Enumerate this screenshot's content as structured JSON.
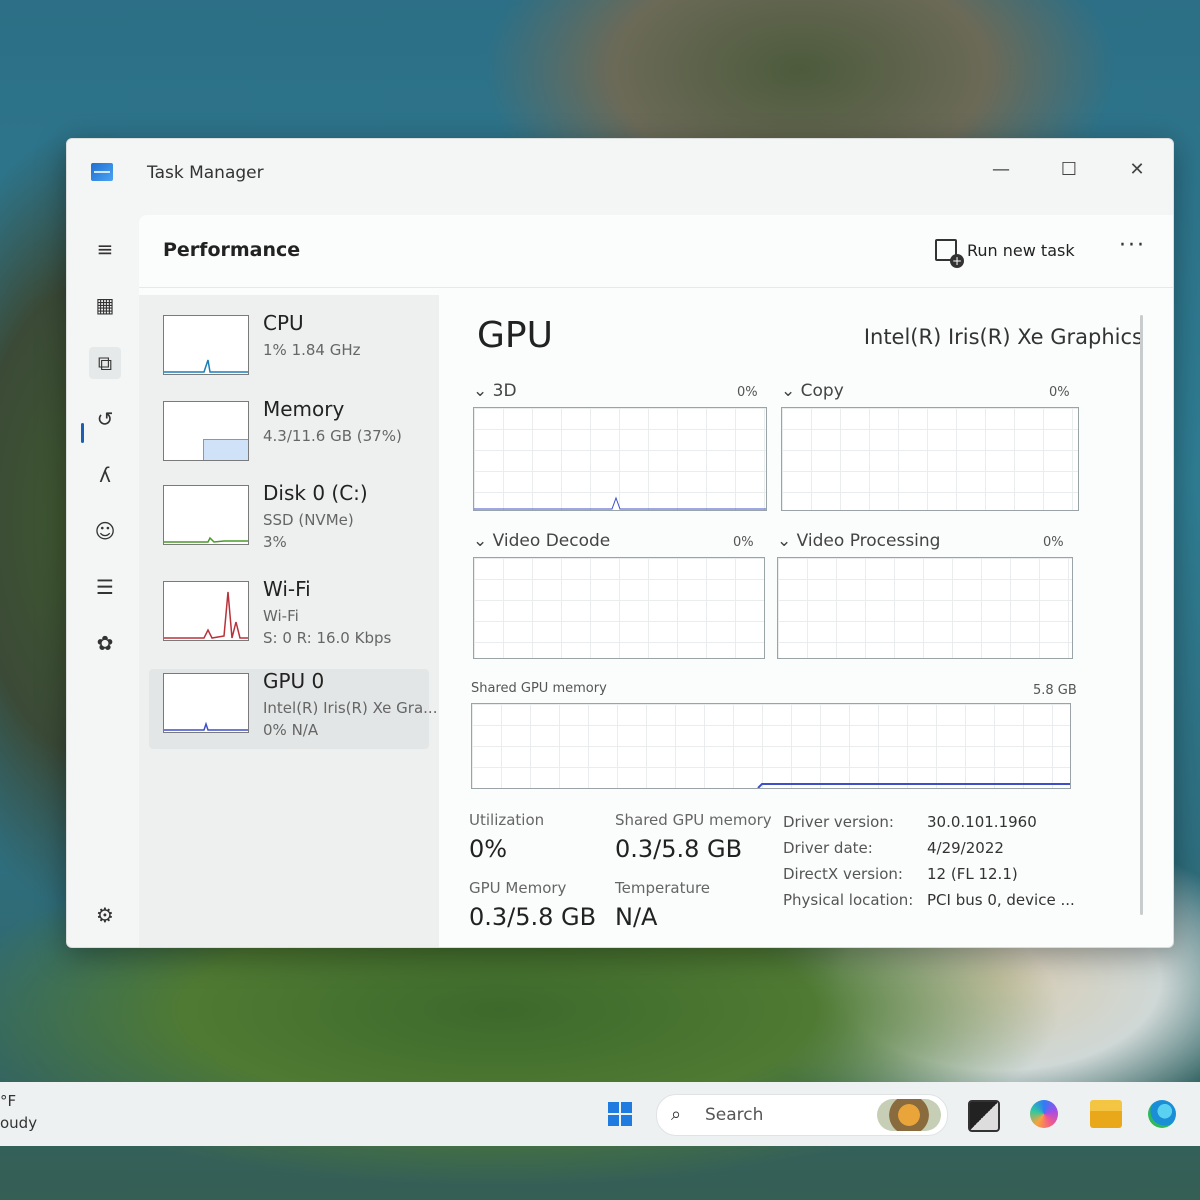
{
  "window": {
    "title": "Task Manager",
    "controls": {
      "minimize": "—",
      "maximize": "☐",
      "close": "✕"
    }
  },
  "nav": {
    "items": [
      {
        "name": "menu",
        "icon": "hamburger-icon",
        "glyph": "≡"
      },
      {
        "name": "processes",
        "icon": "processes-icon",
        "glyph": "▦"
      },
      {
        "name": "performance",
        "icon": "performance-icon",
        "glyph": "⧉",
        "active": true
      },
      {
        "name": "app-history",
        "icon": "history-icon",
        "glyph": "↺"
      },
      {
        "name": "startup-apps",
        "icon": "startup-icon",
        "glyph": "ʎ"
      },
      {
        "name": "users",
        "icon": "users-icon",
        "glyph": "☺"
      },
      {
        "name": "details",
        "icon": "details-icon",
        "glyph": "☰"
      },
      {
        "name": "services",
        "icon": "services-icon",
        "glyph": "✿"
      },
      {
        "name": "settings",
        "icon": "settings-icon",
        "glyph": "⚙"
      }
    ]
  },
  "header": {
    "title": "Performance",
    "run_new_task": "Run new task",
    "more": "···"
  },
  "devices": [
    {
      "name": "CPU",
      "line1": "1%  1.84 GHz",
      "line2": "",
      "color": "#1a7fb8"
    },
    {
      "name": "Memory",
      "line1": "4.3/11.6 GB (37%)",
      "line2": "",
      "color": "#8a3fb0",
      "fill_fraction": 0.37
    },
    {
      "name": "Disk 0 (C:)",
      "line1": "SSD (NVMe)",
      "line2": "3%",
      "color": "#4a9a2a"
    },
    {
      "name": "Wi-Fi",
      "line1": "Wi-Fi",
      "line2": "S: 0  R: 16.0 Kbps",
      "color": "#b8323a"
    },
    {
      "name": "GPU 0",
      "line1": "Intel(R) Iris(R) Xe Gra...",
      "line2": "0%  N/A",
      "color": "#3d4fc9",
      "selected": true
    }
  ],
  "gpu": {
    "title": "GPU",
    "model": "Intel(R) Iris(R) Xe Graphics",
    "engines": [
      {
        "label": "3D",
        "percent": "0%"
      },
      {
        "label": "Copy",
        "percent": "0%"
      },
      {
        "label": "Video Decode",
        "percent": "0%"
      },
      {
        "label": "Video Processing",
        "percent": "0%"
      }
    ],
    "shared_memory_graph": {
      "label": "Shared GPU memory",
      "max": "5.8 GB"
    },
    "stats": [
      {
        "label": "Utilization",
        "value": "0%"
      },
      {
        "label": "Shared GPU memory",
        "value": "0.3/5.8 GB"
      },
      {
        "label": "GPU Memory",
        "value": "0.3/5.8 GB"
      },
      {
        "label": "Temperature",
        "value": "N/A"
      }
    ],
    "info": [
      {
        "key": "Driver version:",
        "value": "30.0.101.1960"
      },
      {
        "key": "Driver date:",
        "value": "4/29/2022"
      },
      {
        "key": "DirectX version:",
        "value": "12 (FL 12.1)"
      },
      {
        "key": "Physical location:",
        "value": "PCI bus 0, device ..."
      }
    ]
  },
  "taskbar": {
    "weather_temp": "°F",
    "weather_text": "oudy",
    "search_placeholder": "Search",
    "search_icon": "search-icon",
    "pinned": [
      "start-icon",
      "task-view-icon",
      "copilot-icon",
      "file-explorer-icon",
      "edge-icon"
    ]
  },
  "colors": {
    "accent": "#1a5fb4",
    "gpu_line": "#3d4fc9"
  }
}
